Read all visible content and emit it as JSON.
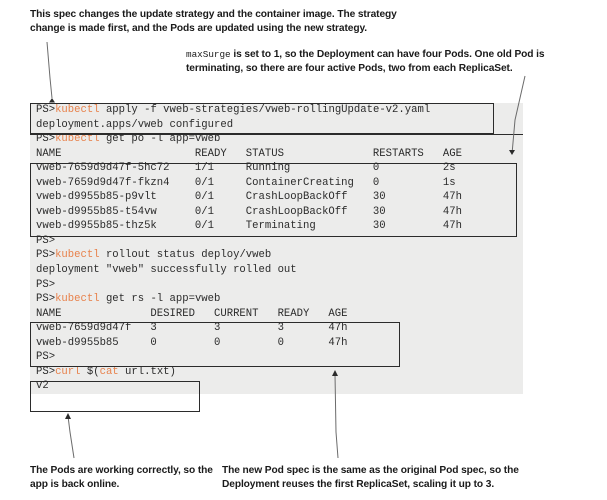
{
  "annotations": {
    "top_left": "This spec changes the update strategy and the container image. The strategy change is made first, and the Pods are updated using the new strategy.",
    "top_right_mono": "maxSurge",
    "top_right_rest": " is set to 1, so the Deployment can have four Pods. One old Pod is terminating, so there are four active Pods, two from each ReplicaSet.",
    "bottom_left": "The Pods are working correctly, so the app is back online.",
    "bottom_right": "The new Pod spec is the same as the original Pod spec, so the Deployment reuses the first ReplicaSet, scaling it up to 3."
  },
  "colors": {
    "terminal_bg": "#ececeb",
    "terminal_fg": "#2b2b2b",
    "command_accent": "#e8824c",
    "border": "#2b2b2b",
    "page_bg": "#ffffff"
  },
  "terminal": {
    "prompt": "PS>",
    "lines": [
      {
        "id": "line-apply-cmd",
        "prompt": "PS>",
        "kw": "kubectl",
        "rest": " apply -f vweb-strategies/vweb-rollingUpdate-v2.yaml"
      },
      {
        "id": "line-apply-out",
        "prompt": "",
        "kw": "",
        "rest": "deployment.apps/vweb configured"
      },
      {
        "id": "line-getpo-cmd",
        "prompt": "PS>",
        "kw": "kubectl",
        "rest": " get po -l app=vweb"
      },
      {
        "id": "line-po-header",
        "prompt": "",
        "kw": "",
        "rest": "NAME                     READY   STATUS              RESTARTS   AGE"
      },
      {
        "id": "line-po-row-1",
        "prompt": "",
        "kw": "",
        "rest": "vweb-7659d9d47f-5hc72    1/1     Running             0          2s"
      },
      {
        "id": "line-po-row-2",
        "prompt": "",
        "kw": "",
        "rest": "vweb-7659d9d47f-fkzn4    0/1     ContainerCreating   0          1s"
      },
      {
        "id": "line-po-row-3",
        "prompt": "",
        "kw": "",
        "rest": "vweb-d9955b85-p9vlt      0/1     CrashLoopBackOff    30         47h"
      },
      {
        "id": "line-po-row-4",
        "prompt": "",
        "kw": "",
        "rest": "vweb-d9955b85-t54vw      0/1     CrashLoopBackOff    30         47h"
      },
      {
        "id": "line-po-row-5",
        "prompt": "",
        "kw": "",
        "rest": "vweb-d9955b85-thz5k      0/1     Terminating         30         47h"
      },
      {
        "id": "line-blank-1",
        "prompt": "PS>",
        "kw": "",
        "rest": ""
      },
      {
        "id": "line-rollout-cmd",
        "prompt": "PS>",
        "kw": "kubectl",
        "rest": " rollout status deploy/vweb"
      },
      {
        "id": "line-rollout-out",
        "prompt": "",
        "kw": "",
        "rest": "deployment \"vweb\" successfully rolled out"
      },
      {
        "id": "line-blank-2",
        "prompt": "PS>",
        "kw": "",
        "rest": ""
      },
      {
        "id": "line-getrs-cmd",
        "prompt": "PS>",
        "kw": "kubectl",
        "rest": " get rs -l app=vweb"
      },
      {
        "id": "line-rs-header",
        "prompt": "",
        "kw": "",
        "rest": "NAME              DESIRED   CURRENT   READY   AGE"
      },
      {
        "id": "line-rs-row-1",
        "prompt": "",
        "kw": "",
        "rest": "vweb-7659d9d47f   3         3         3       47h"
      },
      {
        "id": "line-rs-row-2",
        "prompt": "",
        "kw": "",
        "rest": "vweb-d9955b85     0         0         0       47h"
      },
      {
        "id": "line-blank-3",
        "prompt": "PS>",
        "kw": "",
        "rest": ""
      },
      {
        "id": "line-curl-cmd",
        "prompt": "PS>",
        "kw": "curl",
        "rest": " $(",
        "kw2": "cat",
        "rest2": " url.txt)"
      },
      {
        "id": "line-curl-out",
        "prompt": "",
        "kw": "",
        "rest": "v2"
      }
    ]
  },
  "pod_table": {
    "columns": [
      "NAME",
      "READY",
      "STATUS",
      "RESTARTS",
      "AGE"
    ],
    "rows": [
      [
        "vweb-7659d9d47f-5hc72",
        "1/1",
        "Running",
        "0",
        "2s"
      ],
      [
        "vweb-7659d9d47f-fkzn4",
        "0/1",
        "ContainerCreating",
        "0",
        "1s"
      ],
      [
        "vweb-d9955b85-p9vlt",
        "0/1",
        "CrashLoopBackOff",
        "30",
        "47h"
      ],
      [
        "vweb-d9955b85-t54vw",
        "0/1",
        "CrashLoopBackOff",
        "30",
        "47h"
      ],
      [
        "vweb-d9955b85-thz5k",
        "0/1",
        "Terminating",
        "30",
        "47h"
      ]
    ]
  },
  "rs_table": {
    "columns": [
      "NAME",
      "DESIRED",
      "CURRENT",
      "READY",
      "AGE"
    ],
    "rows": [
      [
        "vweb-7659d9d47f",
        "3",
        "3",
        "3",
        "47h"
      ],
      [
        "vweb-d9955b85",
        "0",
        "0",
        "0",
        "47h"
      ]
    ]
  }
}
